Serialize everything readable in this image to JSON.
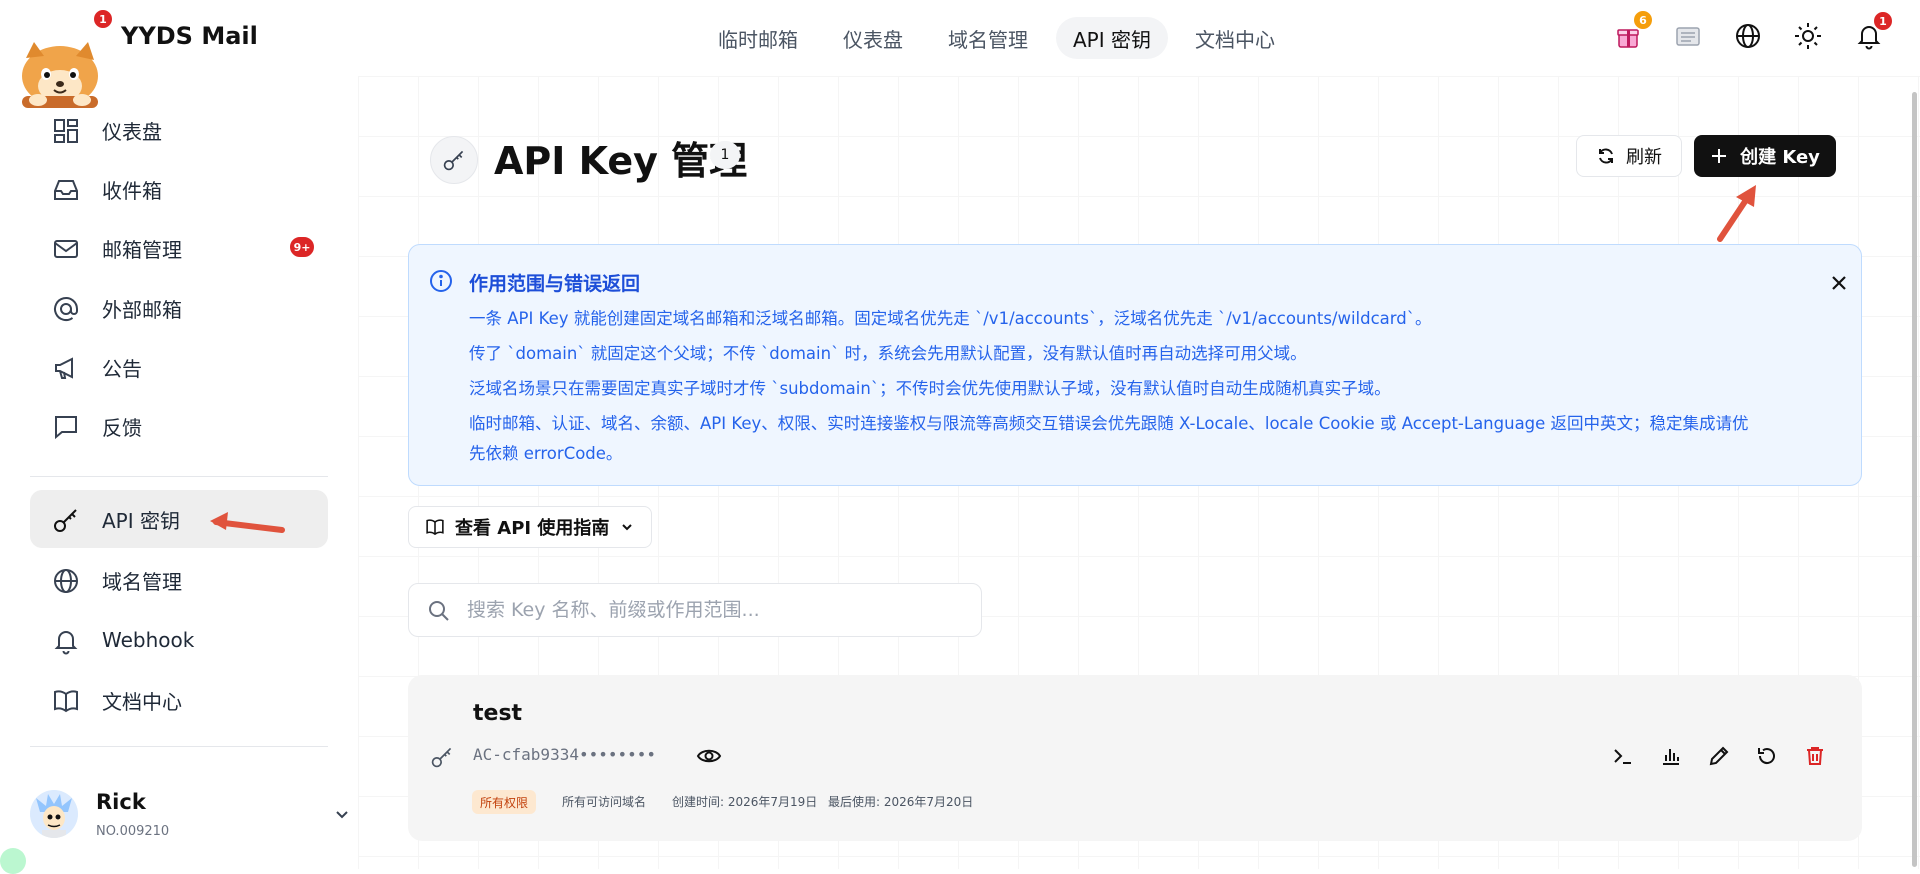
{
  "header": {
    "brand": "YYDS Mail",
    "brand_badge": "1",
    "nav": [
      {
        "label": "临时邮箱"
      },
      {
        "label": "仪表盘"
      },
      {
        "label": "域名管理"
      },
      {
        "label": "API 密钥"
      },
      {
        "label": "文档中心"
      }
    ],
    "gift_badge": "6",
    "bell_badge": "1"
  },
  "sidebar": {
    "items": [
      {
        "label": "仪表盘",
        "icon": "dashboard-icon"
      },
      {
        "label": "收件箱",
        "icon": "inbox-icon"
      },
      {
        "label": "邮箱管理",
        "icon": "mail-icon",
        "badge": "9+"
      },
      {
        "label": "外部邮箱",
        "icon": "at-icon"
      },
      {
        "label": "公告",
        "icon": "megaphone-icon"
      },
      {
        "label": "反馈",
        "icon": "message-icon"
      },
      {
        "label": "API 密钥",
        "icon": "key-icon"
      },
      {
        "label": "域名管理",
        "icon": "globe-icon"
      },
      {
        "label": "Webhook",
        "icon": "bell-icon"
      },
      {
        "label": "文档中心",
        "icon": "book-icon"
      }
    ],
    "user": {
      "name": "Rick",
      "id": "NO.009210"
    }
  },
  "main": {
    "title": "API Key 管理",
    "count": "1",
    "refresh_label": "刷新",
    "create_label": "创建 Key",
    "info": {
      "title": "作用范围与错误返回",
      "lines": [
        "一条 API Key 就能创建固定域名邮箱和泛域名邮箱。固定域名优先走 `/v1/accounts`，泛域名优先走 `/v1/accounts/wildcard`。",
        "传了 `domain` 就固定这个父域；不传 `domain` 时，系统会先用默认配置，没有默认值时再自动选择可用父域。",
        "泛域名场景只在需要固定真实子域时才传 `subdomain`；不传时会优先使用默认子域，没有默认值时自动生成随机真实子域。",
        "临时邮箱、认证、域名、余额、API Key、权限、实时连接鉴权与限流等高频交互错误会优先跟随 X-Locale、locale Cookie 或 Accept-Language 返回中英文；稳定集成请优",
        "先依赖 errorCode。"
      ]
    },
    "guide_label": "查看 API 使用指南",
    "search_placeholder": "搜索 Key 名称、前缀或作用范围...",
    "key": {
      "name": "test",
      "value": "AC-cfab9334••••••••",
      "permission": "所有权限",
      "domains": "所有可访问域名",
      "created": "创建时间: 2026年7月19日",
      "last_used": "最后使用: 2026年7月20日"
    }
  },
  "colors": {
    "accent_blue": "#2563eb",
    "danger": "#dc2626",
    "annotation_arrow": "#e0533d"
  }
}
